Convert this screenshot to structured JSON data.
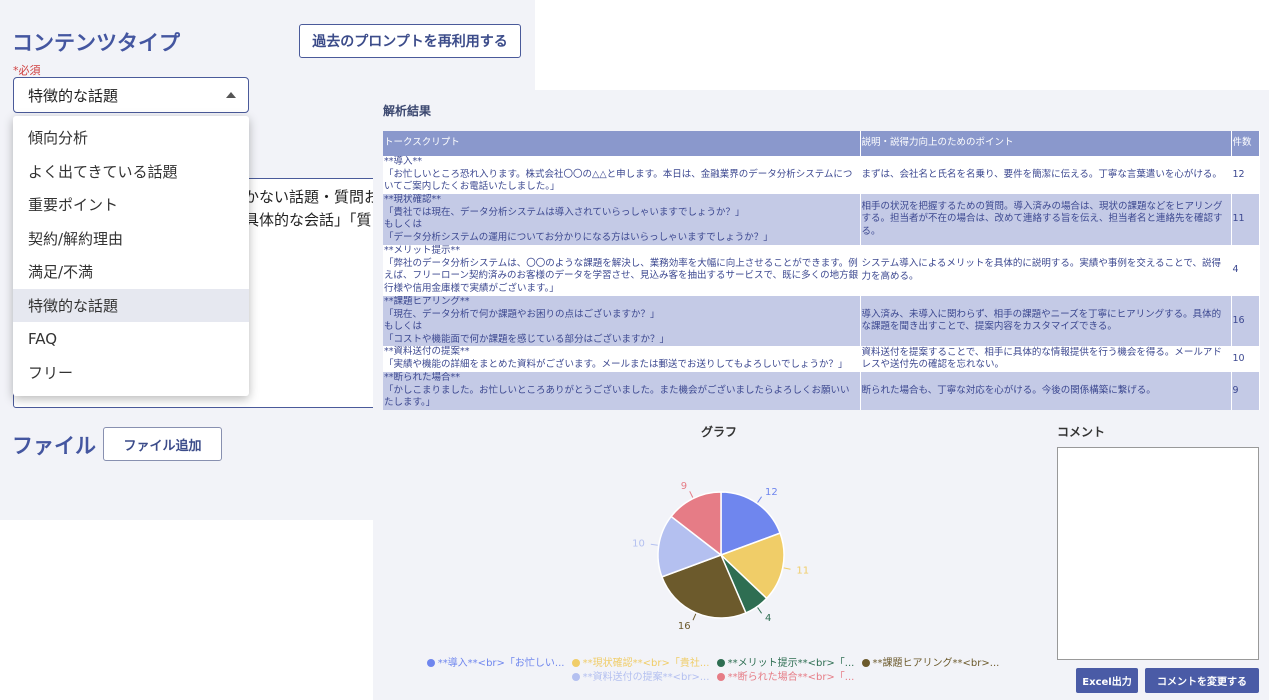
{
  "content_type": {
    "title": "コンテンツタイプ",
    "required_label": "*必須",
    "selected": "特徴的な話題",
    "options": [
      "傾向分析",
      "よく出てきている話題",
      "重要ポイント",
      "契約/解約理由",
      "満足/不満",
      "特徴的な話題",
      "FAQ",
      "フリー"
    ],
    "reuse_button": "過去のプロンプトを再利用する"
  },
  "prompt": {
    "line1": "かない話題・質問お",
    "line2": "具体的な会話」「質"
  },
  "file": {
    "title": "ファイル",
    "add_button": "ファイル追加"
  },
  "results": {
    "title": "解析結果",
    "columns": [
      "トークスクリプト",
      "説明・説得力向上のためのポイント",
      "件数"
    ],
    "rows": [
      {
        "script": "**導入**\n「お忙しいところ恐れ入ります。株式会社〇〇の△△と申します。本日は、金融業界のデータ分析システムについてご案内したくお電話いたしました。」",
        "point": "まずは、会社名と氏名を名乗り、要件を簡潔に伝える。丁寧な言葉遣いを心がける。",
        "count": "12"
      },
      {
        "script": "**現状確認**\n「貴社では現在、データ分析システムは導入されていらっしゃいますでしょうか？」\nもしくは\n「データ分析システムの運用についてお分かりになる方はいらっしゃいますでしょうか？」",
        "point": "相手の状況を把握するための質問。導入済みの場合は、現状の課題などをヒアリングする。担当者が不在の場合は、改めて連絡する旨を伝え、担当者名と連絡先を確認する。",
        "count": "11"
      },
      {
        "script": "**メリット提示**\n「弊社のデータ分析システムは、〇〇のような課題を解決し、業務効率を大幅に向上させることができます。例えば、フリーローン契約済みのお客様のデータを学習させ、見込み客を抽出するサービスで、既に多くの地方銀行様や信用金庫様で実績がございます。」",
        "point": "システム導入によるメリットを具体的に説明する。実績や事例を交えることで、説得力を高める。",
        "count": "4"
      },
      {
        "script": "**課題ヒアリング**\n「現在、データ分析で何か課題やお困りの点はございますか？」\nもしくは\n「コストや機能面で何か課題を感じている部分はございますか？」",
        "point": "導入済み、未導入に関わらず、相手の課題やニーズを丁寧にヒアリングする。具体的な課題を聞き出すことで、提案内容をカスタマイズできる。",
        "count": "16"
      },
      {
        "script": "**資料送付の提案**\n「実績や機能の詳細をまとめた資料がございます。メールまたは郵送でお送りしてもよろしいでしょうか？」",
        "point": "資料送付を提案することで、相手に具体的な情報提供を行う機会を得る。メールアドレスや送付先の確認を忘れない。",
        "count": "10"
      },
      {
        "script": "**断られた場合**\n「かしこまりました。お忙しいところありがとうございました。また機会がございましたらよろしくお願いいたします。」",
        "point": "断られた場合も、丁寧な対応を心がける。今後の関係構築に繋げる。",
        "count": "9"
      }
    ]
  },
  "chart_data": {
    "type": "pie",
    "title": "グラフ",
    "categories": [
      "**導入**<br>「お忙しい...",
      "**現状確認**<br>「貴社...",
      "**メリット提示**<br>「...",
      "**課題ヒアリング**<br>...",
      "**資料送付の提案**<br>...",
      "**断られた場合**<br>「..."
    ],
    "values": [
      12,
      11,
      4,
      16,
      10,
      9
    ],
    "colors": [
      "#6f86ee",
      "#f0cd68",
      "#2e6e52",
      "#6c5a2c",
      "#b4c0f0",
      "#e67c86"
    ],
    "legend_position": "bottom"
  },
  "comment": {
    "title": "コメント",
    "value": "",
    "excel_button": "Excel出力",
    "change_button": "コメントを変更する"
  }
}
